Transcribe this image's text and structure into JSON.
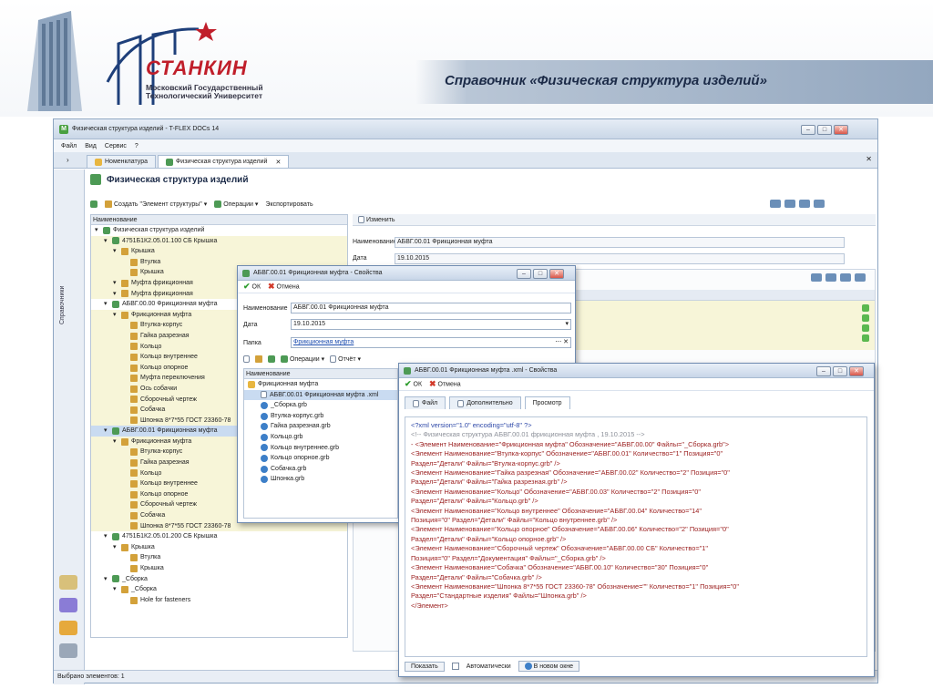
{
  "slide": {
    "logo_name": "СТАНКИН",
    "logo_sub": "Московский Государственный Технологический Университет",
    "title": "Справочник «Физическая структура изделий»"
  },
  "app": {
    "title": "Физическая структура изделий - T-FLEX DOCs 14",
    "menu": [
      "Файл",
      "Вид",
      "Сервис",
      "?"
    ],
    "tabs": [
      {
        "label": "Номенклатура"
      },
      {
        "label": "Физическая структура изделий"
      }
    ],
    "pane_title": "Физическая структура изделий",
    "toolbar": {
      "create": "Создать \"Элемент структуры\"",
      "operations": "Операции",
      "export": "Экспортировать"
    },
    "left_strip_label": "Справочники",
    "tree": {
      "header": "Наименование",
      "rows": [
        {
          "label": "Физическая структура изделий",
          "indent": 0,
          "icon": "struct"
        },
        {
          "label": "4751Б1К2.05.01.100 СБ Крышка",
          "indent": 1,
          "icon": "struct"
        },
        {
          "label": "Крышка",
          "indent": 2,
          "icon": "box"
        },
        {
          "label": "Втулка",
          "indent": 3,
          "icon": "box"
        },
        {
          "label": "Крышка",
          "indent": 3,
          "icon": "box"
        },
        {
          "label": "Муфта фрикционная",
          "indent": 2,
          "icon": "box"
        },
        {
          "label": "Муфта фрикционная",
          "indent": 2,
          "icon": "box"
        },
        {
          "label": "АБВГ.00.00 Фрикционная муфта",
          "indent": 1,
          "icon": "struct"
        },
        {
          "label": "Фрикционная муфта",
          "indent": 2,
          "icon": "box"
        },
        {
          "label": "Втулка-корпус",
          "indent": 3,
          "icon": "box"
        },
        {
          "label": "Гайка разрезная",
          "indent": 3,
          "icon": "box"
        },
        {
          "label": "Кольцо",
          "indent": 3,
          "icon": "box"
        },
        {
          "label": "Кольцо внутреннее",
          "indent": 3,
          "icon": "box"
        },
        {
          "label": "Кольцо опорное",
          "indent": 3,
          "icon": "box"
        },
        {
          "label": "Муфта переключения",
          "indent": 3,
          "icon": "box"
        },
        {
          "label": "Ось собачки",
          "indent": 3,
          "icon": "box"
        },
        {
          "label": "Сборочный чертеж",
          "indent": 3,
          "icon": "box"
        },
        {
          "label": "Собачка",
          "indent": 3,
          "icon": "box"
        },
        {
          "label": "Шпонка 8*7*55 ГОСТ 23360-78",
          "indent": 3,
          "icon": "box"
        },
        {
          "label": "АБВГ.00.01 Фрикционная муфта",
          "indent": 1,
          "icon": "struct",
          "selected": true
        },
        {
          "label": "Фрикционная муфта",
          "indent": 2,
          "icon": "box"
        },
        {
          "label": "Втулка-корпус",
          "indent": 3,
          "icon": "box"
        },
        {
          "label": "Гайка разрезная",
          "indent": 3,
          "icon": "box"
        },
        {
          "label": "Кольцо",
          "indent": 3,
          "icon": "box"
        },
        {
          "label": "Кольцо внутреннее",
          "indent": 3,
          "icon": "box"
        },
        {
          "label": "Кольцо опорное",
          "indent": 3,
          "icon": "box"
        },
        {
          "label": "Сборочный чертеж",
          "indent": 3,
          "icon": "box"
        },
        {
          "label": "Собачка",
          "indent": 3,
          "icon": "box"
        },
        {
          "label": "Шпонка 8*7*55 ГОСТ 23360-78",
          "indent": 3,
          "icon": "box"
        },
        {
          "label": "4751Б1К2.05.01.200 СБ Крышка",
          "indent": 1,
          "icon": "struct"
        },
        {
          "label": "Крышка",
          "indent": 2,
          "icon": "box"
        },
        {
          "label": "Втулка",
          "indent": 3,
          "icon": "box"
        },
        {
          "label": "Крышка",
          "indent": 3,
          "icon": "box"
        },
        {
          "label": "_Сборка",
          "indent": 1,
          "icon": "struct"
        },
        {
          "label": "_Сборка",
          "indent": 2,
          "icon": "box"
        },
        {
          "label": "Hole for fasteners",
          "indent": 3,
          "icon": "box"
        }
      ]
    },
    "props": {
      "edit_label": "Изменить",
      "name_label": "Наименование",
      "name_value": "АБВГ.00.01 Фрикционная муфта",
      "date_label": "Дата",
      "date_value": "19.10.2015"
    },
    "status": "Выбрано элементов: 1"
  },
  "dialog1": {
    "title": "АБВГ.00.01 Фрикционная муфта - Свойства",
    "ok": "ОК",
    "cancel": "Отмена",
    "name_label": "Наименование",
    "name_value": "АБВГ.00.01 Фрикционная муфта",
    "date_label": "Дата",
    "date_value": "19.10.2015",
    "folder_label": "Папка",
    "folder_value": "Фрикционная муфта",
    "operations": "Операции",
    "report": "Отчёт",
    "list_header": "Наименование",
    "files": [
      {
        "label": "Фрикционная муфта",
        "indent": 0,
        "icon": "folder"
      },
      {
        "label": "АБВГ.00.01 Фрикционная муфта .xml",
        "indent": 1,
        "icon": "doc"
      },
      {
        "label": "_Сборка.grb",
        "indent": 1,
        "icon": "file"
      },
      {
        "label": "Втулка-корпус.grb",
        "indent": 1,
        "icon": "file"
      },
      {
        "label": "Гайка разрезная.grb",
        "indent": 1,
        "icon": "file"
      },
      {
        "label": "Кольцо.grb",
        "indent": 1,
        "icon": "file"
      },
      {
        "label": "Кольцо внутреннее.grb",
        "indent": 1,
        "icon": "file"
      },
      {
        "label": "Кольцо опорное.grb",
        "indent": 1,
        "icon": "file"
      },
      {
        "label": "Собачка.grb",
        "indent": 1,
        "icon": "file"
      },
      {
        "label": "Шпонка.grb",
        "indent": 1,
        "icon": "file"
      }
    ]
  },
  "dialog2": {
    "title": "АБВГ.00.01 Фрикционная муфта .xml - Свойства",
    "ok": "ОК",
    "cancel": "Отмена",
    "tabs": [
      "Файл",
      "Дополнительно",
      "Просмотр"
    ],
    "show_button": "Показать",
    "auto_label": "Автоматически",
    "new_window": "В новом окне",
    "xml_lines": [
      {
        "text": "<?xml version=\"1.0\" encoding=\"utf-8\" ?>",
        "cls": "x-pi"
      },
      {
        "text": "<!-- Физическая структура АБВГ.00.01 фрикционная муфта , 19.10.2015 -->",
        "cls": "x-cm"
      },
      {
        "text": "- <Элемент Наименование=\"Фрикционная муфта\" Обозначение=\"АБВГ.00.00\" Файлы=\"_Сборка.grb\">",
        "cls": "x-tag"
      },
      {
        "text": "  <Элемент Наименование=\"Втулка-корпус\" Обозначение=\"АБВГ.00.01\" Количество=\"1\" Позиция=\"0\"",
        "cls": "x-tag"
      },
      {
        "text": "     Раздел=\"Детали\" Файлы=\"Втулка-корпус.grb\" />",
        "cls": "x-tag"
      },
      {
        "text": "  <Элемент Наименование=\"Гайка разрезная\" Обозначение=\"АБВГ.00.02\" Количество=\"2\" Позиция=\"0\"",
        "cls": "x-tag"
      },
      {
        "text": "     Раздел=\"Детали\" Файлы=\"Гайка разрезная.grb\" />",
        "cls": "x-tag"
      },
      {
        "text": "  <Элемент Наименование=\"Кольцо\" Обозначение=\"АБВГ.00.03\" Количество=\"2\" Позиция=\"0\"",
        "cls": "x-tag"
      },
      {
        "text": "     Раздел=\"Детали\" Файлы=\"Кольцо.grb\" />",
        "cls": "x-tag"
      },
      {
        "text": "  <Элемент Наименование=\"Кольцо внутреннее\" Обозначение=\"АБВГ.00.04\" Количество=\"14\"",
        "cls": "x-tag"
      },
      {
        "text": "     Позиция=\"0\" Раздел=\"Детали\" Файлы=\"Кольцо внутреннее.grb\" />",
        "cls": "x-tag"
      },
      {
        "text": "  <Элемент Наименование=\"Кольцо опорное\" Обозначение=\"АБВГ.00.06\" Количество=\"2\" Позиция=\"0\"",
        "cls": "x-tag"
      },
      {
        "text": "     Раздел=\"Детали\" Файлы=\"Кольцо опорное.grb\" />",
        "cls": "x-tag"
      },
      {
        "text": "  <Элемент Наименование=\"Сборочный чертеж\" Обозначение=\"АБВГ.00.00 СБ\" Количество=\"1\"",
        "cls": "x-tag"
      },
      {
        "text": "     Позиция=\"0\" Раздел=\"Документация\" Файлы=\"_Сборка.grb\" />",
        "cls": "x-tag"
      },
      {
        "text": "  <Элемент Наименование=\"Собачка\" Обозначение=\"АБВГ.00.10\" Количество=\"30\" Позиция=\"0\"",
        "cls": "x-tag"
      },
      {
        "text": "     Раздел=\"Детали\" Файлы=\"Собачка.grb\" />",
        "cls": "x-tag"
      },
      {
        "text": "  <Элемент Наименование=\"Шпонка 8*7*55 ГОСТ 23360-78\" Обозначение=\"\" Количество=\"1\" Позиция=\"0\"",
        "cls": "x-tag"
      },
      {
        "text": "     Раздел=\"Стандартные изделия\" Файлы=\"Шпонка.grb\" />",
        "cls": "x-tag"
      },
      {
        "text": "</Элемент>",
        "cls": "x-tag"
      }
    ]
  }
}
